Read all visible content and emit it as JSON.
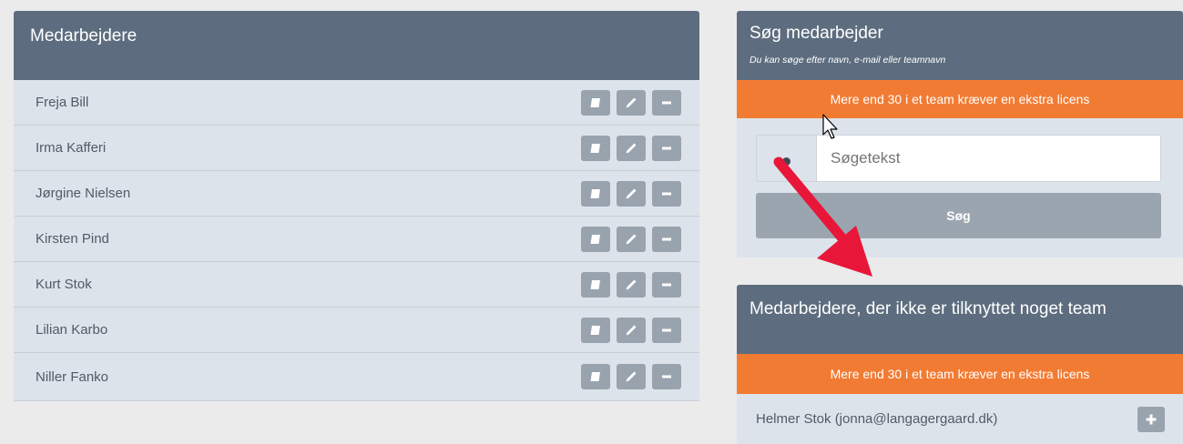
{
  "employees_panel": {
    "title": "Medarbejdere",
    "rows": [
      {
        "name": "Freja Bill"
      },
      {
        "name": "Irma Kafferi"
      },
      {
        "name": "Jørgine Nielsen"
      },
      {
        "name": "Kirsten Pind"
      },
      {
        "name": "Kurt Stok"
      },
      {
        "name": "Lilian Karbo"
      },
      {
        "name": "Niller Fanko"
      }
    ],
    "row_actions": [
      "note-icon",
      "pencil-icon",
      "minus-icon"
    ]
  },
  "search_panel": {
    "title": "Søg medarbejder",
    "subtitle": "Du kan søge efter navn, e-mail eller teamnavn",
    "banner": "Mere end 30 i et team kræver en ekstra licens",
    "input_placeholder": "Søgetekst",
    "input_value": "",
    "button_label": "Søg"
  },
  "unassigned_panel": {
    "title": "Medarbejdere, der ikke er tilknyttet noget team",
    "banner": "Mere end 30 i et team kræver en ekstra licens",
    "rows": [
      {
        "label": "Helmer Stok (jonna@langagergaard.dk)"
      }
    ]
  },
  "colors": {
    "panel_header": "#5d6d7f",
    "row_bg": "#dde3ea",
    "banner": "#f27b33",
    "button": "#9ba5b0",
    "annotation_arrow": "#e8173a"
  }
}
